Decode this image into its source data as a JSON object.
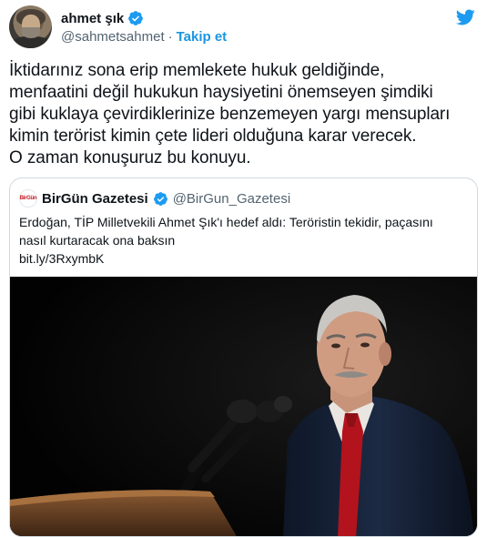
{
  "author": {
    "display_name": "ahmet şık",
    "handle": "@sahmetsahmet",
    "separator": "·",
    "follow_label": "Takip et",
    "verified": true
  },
  "tweet": {
    "lines": [
      "İktidarınız sona erip memlekete hukuk geldiğinde,",
      "menfaatini değil hukukun haysiyetini önemseyen şimdiki",
      "gibi kuklaya çevirdiklerinize benzemeyen yargı mensupları",
      "kimin terörist kimin çete lideri olduğuna karar verecek.",
      "O zaman konuşuruz bu konuyu."
    ]
  },
  "quoted": {
    "avatar_text": "BirGün",
    "display_name": "BirGün Gazetesi",
    "handle": "@BirGun_Gazetesi",
    "verified": true,
    "text_lines": [
      "Erdoğan, TİP Milletvekili Ahmet Şık'ı hedef aldı: Teröristin tekidir, paçasını",
      "nasıl kurtaracak ona baksın"
    ],
    "link": "bit.ly/3RxymbK"
  },
  "colors": {
    "twitter_blue": "#1d9bf0",
    "link_blue": "#1b95e0",
    "secondary_text": "#536471",
    "border": "#cfd9de"
  },
  "icons": [
    "verified-badge-icon",
    "twitter-bird-icon"
  ]
}
